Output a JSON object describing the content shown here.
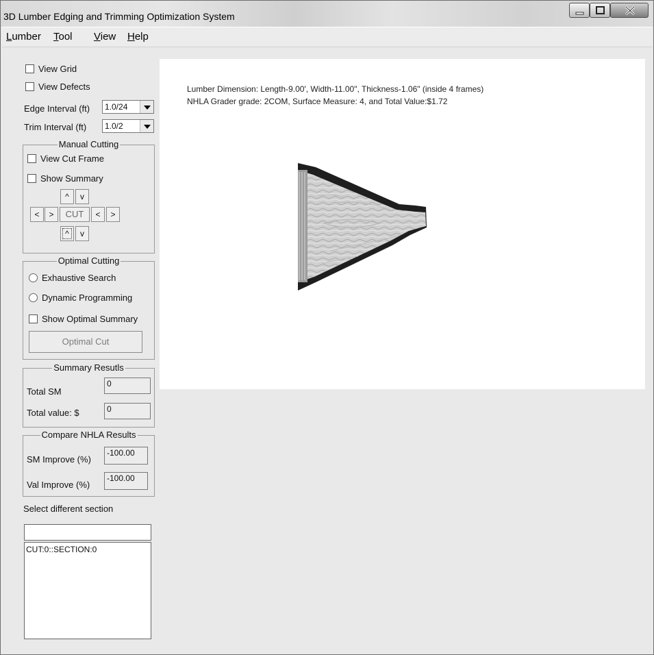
{
  "window": {
    "title": "3D Lumber Edging and Trimming Optimization System"
  },
  "menu": [
    {
      "accel": "L",
      "rest": "umber"
    },
    {
      "accel": "T",
      "rest": "ool"
    },
    {
      "accel": "V",
      "rest": "iew"
    },
    {
      "accel": "H",
      "rest": "elp"
    }
  ],
  "view_options": {
    "grid": "View Grid",
    "defects": "View Defects"
  },
  "intervals": {
    "edge_label": "Edge Interval (ft)",
    "edge_value": "1.0/24",
    "trim_label": "Trim Interval (ft)",
    "trim_value": "1.0/2"
  },
  "manual_cutting": {
    "title": "Manual Cutting",
    "view_cut_frame": "View Cut Frame",
    "show_summary": "Show Summary",
    "up": "^",
    "down": "v",
    "left": "<",
    "right": ">",
    "cut": "CUT"
  },
  "optimal_cutting": {
    "title": "Optimal Cutting",
    "exhaustive": "Exhaustive Search",
    "dynamic": "Dynamic Programming",
    "show_optimal_summary": "Show Optimal Summary",
    "optimal_cut_button": "Optimal Cut"
  },
  "summary_results": {
    "title": "Summary Resutls",
    "total_sm_label": "Total SM",
    "total_sm_value": "0",
    "total_value_label": "Total value: $",
    "total_value_value": "0"
  },
  "compare_nhla": {
    "title": "Compare NHLA Results",
    "sm_label": "SM Improve (%)",
    "sm_value": "-100.00",
    "val_label": "Val Improve (%)",
    "val_value": "-100.00"
  },
  "section": {
    "label": "Select different section",
    "input_value": "",
    "list": [
      "CUT:0::SECTION:0"
    ]
  },
  "canvas": {
    "line1": "Lumber Dimension: Length-9.00', Width-11.00\", Thickness-1.06\" (inside 4 frames)",
    "line2": "NHLA Grader grade: 2COM, Surface Measure: 4, and Total Value:$1.72"
  }
}
